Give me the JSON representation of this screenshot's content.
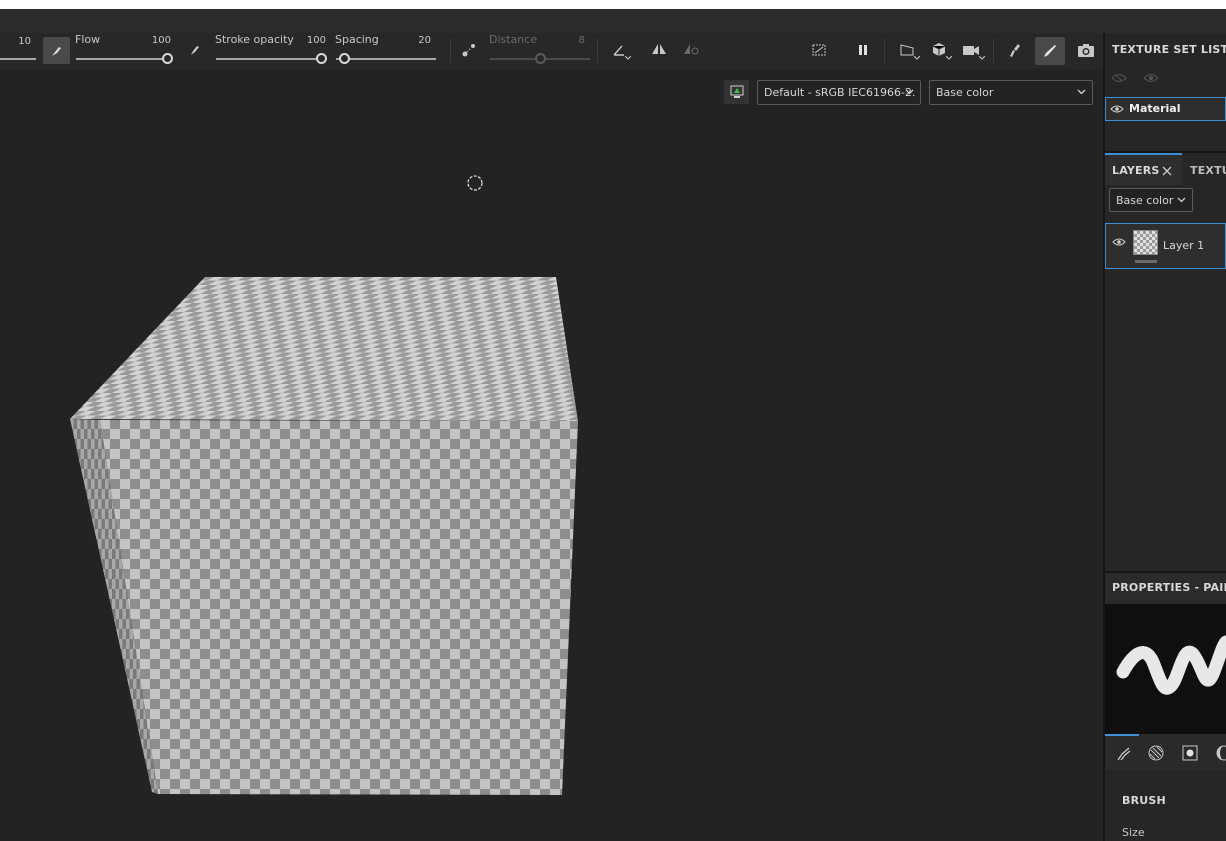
{
  "toolbar": {
    "size_value": "10",
    "flow_label": "Flow",
    "flow_value": "100",
    "stroke_opacity_label": "Stroke opacity",
    "stroke_opacity_value": "100",
    "spacing_label": "Spacing",
    "spacing_value": "20",
    "distance_label": "Distance",
    "distance_value": "8",
    "flow_level": 1.0,
    "stroke_opacity_level": 1.0,
    "spacing_level": 0.08,
    "distance_level": 0.5
  },
  "viewport": {
    "colorspace_dropdown": "Default - sRGB IEC61966-2.",
    "channel_dropdown": "Base color"
  },
  "texture_set_list": {
    "title": "TEXTURE SET LIST",
    "material": "Material"
  },
  "layers": {
    "tab_layers": "LAYERS",
    "tab_textures": "TEXTU",
    "channel_dropdown": "Base color",
    "layer_name": "Layer 1"
  },
  "properties": {
    "title": "PROPERTIES - PAINT",
    "section": "BRUSH",
    "size_label": "Size"
  },
  "icons": [
    "brush-tip-icon",
    "pen-pressure-icon",
    "pen-icon",
    "lazy-mouse-icon",
    "symmetry-icon",
    "symmetry-mode-icon",
    "hide-icon",
    "pause-icon",
    "projection-icon",
    "cube-icon",
    "camera-icon",
    "smudge-icon",
    "paint-brush-icon",
    "screenshot-icon",
    "display-icon",
    "eye-icon",
    "close-icon",
    "chevron-down-icon"
  ],
  "colors": {
    "accent": "#3d8fd1",
    "panel": "#262626",
    "viewport": "#232323"
  }
}
